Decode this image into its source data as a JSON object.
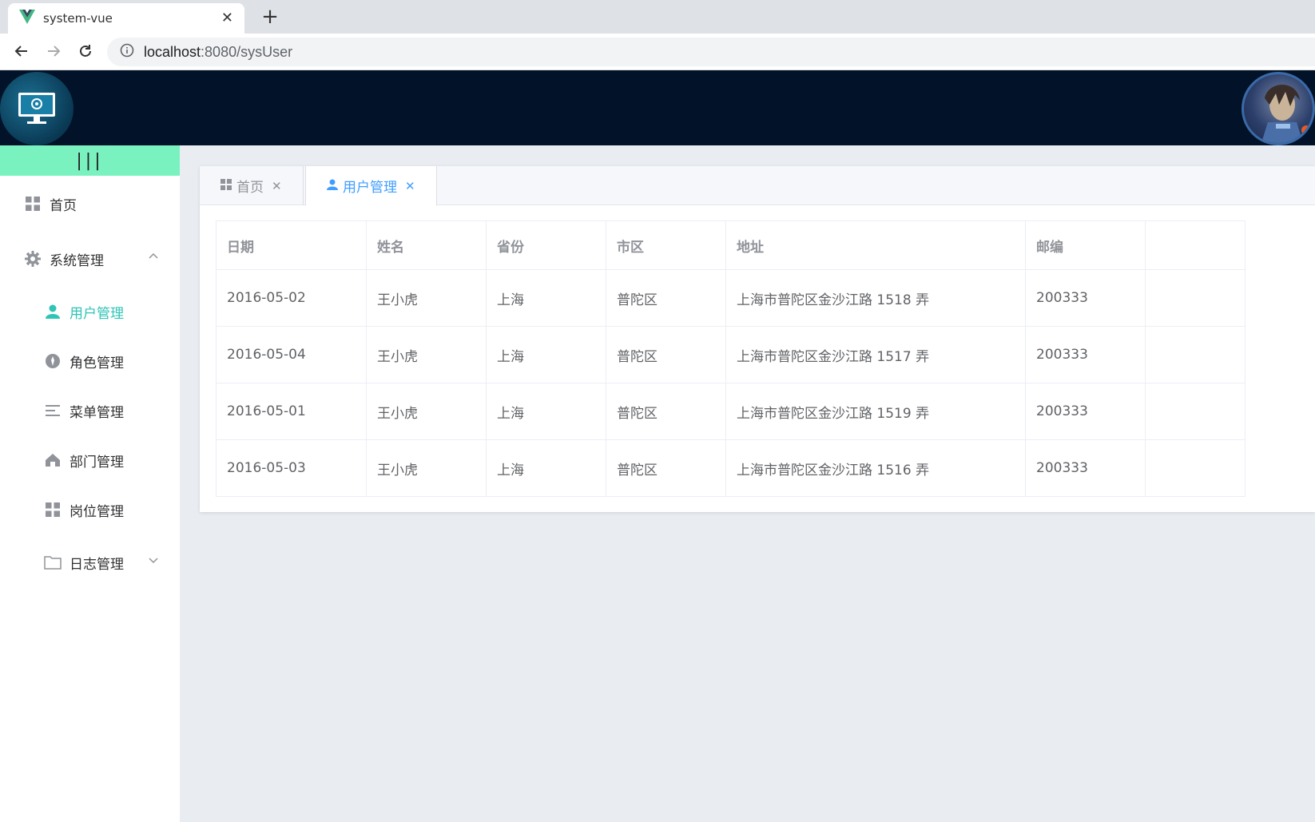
{
  "browser": {
    "tab_title": "system-vue",
    "new_tab": "+",
    "close": "✕",
    "url_host": "localhost",
    "url_rest": ":8080/sysUser"
  },
  "sidebar": {
    "collapse": "|||",
    "items": [
      {
        "label": "首页"
      },
      {
        "label": "系统管理"
      },
      {
        "label": "用户管理"
      },
      {
        "label": "角色管理"
      },
      {
        "label": "菜单管理"
      },
      {
        "label": "部门管理"
      },
      {
        "label": "岗位管理"
      },
      {
        "label": "日志管理"
      }
    ]
  },
  "page_tabs": [
    {
      "label": "首页",
      "close": "✕"
    },
    {
      "label": "用户管理",
      "close": "✕"
    }
  ],
  "table": {
    "headers": [
      "日期",
      "姓名",
      "省份",
      "市区",
      "地址",
      "邮编",
      ""
    ],
    "rows": [
      [
        "2016-05-02",
        "王小虎",
        "上海",
        "普陀区",
        "上海市普陀区金沙江路 1518 弄",
        "200333",
        ""
      ],
      [
        "2016-05-04",
        "王小虎",
        "上海",
        "普陀区",
        "上海市普陀区金沙江路 1517 弄",
        "200333",
        ""
      ],
      [
        "2016-05-01",
        "王小虎",
        "上海",
        "普陀区",
        "上海市普陀区金沙江路 1519 弄",
        "200333",
        ""
      ],
      [
        "2016-05-03",
        "王小虎",
        "上海",
        "普陀区",
        "上海市普陀区金沙江路 1516 弄",
        "200333",
        ""
      ]
    ]
  },
  "colors": {
    "header_bg": "#021329",
    "collapse_bar": "#79f2c0",
    "active_menu": "#2ec4b6",
    "active_tab": "#409eff"
  },
  "icons": {
    "home": "grid-icon",
    "system": "gear-icon",
    "user": "user-icon",
    "role": "role-icon",
    "menu": "menu-icon",
    "dept": "house-icon",
    "post": "grid-icon",
    "log": "folder-icon"
  }
}
